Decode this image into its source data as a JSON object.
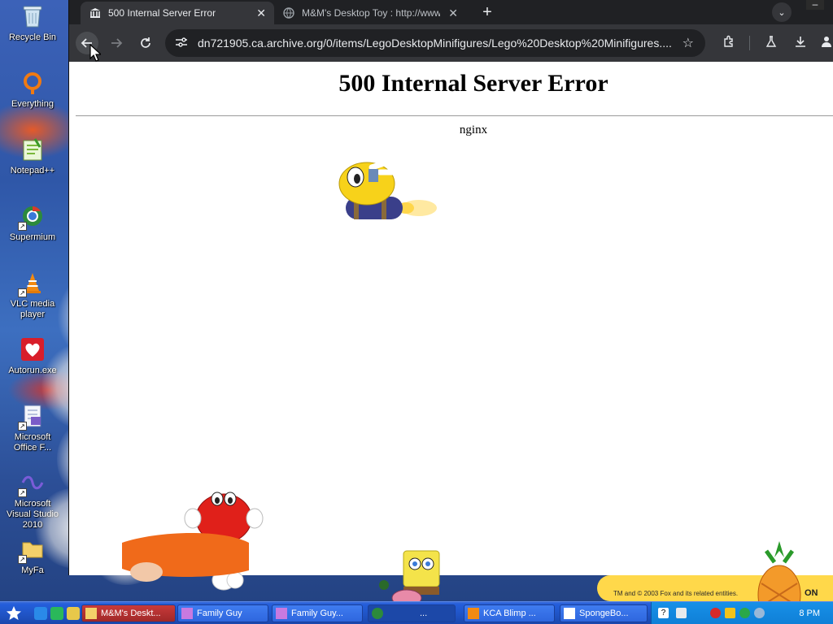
{
  "desktop": {
    "icons": [
      {
        "label": "Recycle Bin",
        "icon": "recycle-bin-icon"
      },
      {
        "label": "Everything",
        "icon": "everything-search-icon"
      },
      {
        "label": "Notepad++",
        "icon": "notepad-plus-plus-icon"
      },
      {
        "label": "Supermium",
        "icon": "supermium-browser-icon"
      },
      {
        "label": "VLC media player",
        "icon": "vlc-cone-icon"
      },
      {
        "label": "Autorun.exe",
        "icon": "autorun-heart-logo-icon"
      },
      {
        "label": "Microsoft Office F...",
        "icon": "office-document-icon"
      },
      {
        "label": "Microsoft Visual Studio 2010",
        "icon": "visual-studio-icon"
      },
      {
        "label": "MyFa",
        "icon": "folder-shortcut-icon"
      }
    ]
  },
  "browser": {
    "tabs": [
      {
        "title": "500 Internal Server Error",
        "favicon": "archive-building-icon",
        "active": true
      },
      {
        "title": "M&M's Desktop Toy : http://www.c",
        "favicon": "globe-icon",
        "active": false
      }
    ],
    "address": "dn721905.ca.archive.org/0/items/LegoDesktopMinifigures/Lego%20Desktop%20Minifigures....",
    "page": {
      "heading": "500 Internal Server Error",
      "server": "nginx"
    }
  },
  "banner": {
    "credit": "TM and © 2003 Fox and its related entities.",
    "on": "ON"
  },
  "taskbar": {
    "tasks": [
      {
        "label": "M&M's Deskt..."
      },
      {
        "label": "Family Guy"
      },
      {
        "label": "Family Guy..."
      },
      {
        "label": "..."
      },
      {
        "label": "KCA Blimp ..."
      },
      {
        "label": "SpongeBo..."
      }
    ],
    "clock": "8 PM"
  },
  "colors": {
    "chrome_dark": "#202124",
    "chrome_toolbar": "#35363a",
    "taskbar_blue": "#245edb",
    "tray_blue": "#0f7fd6"
  }
}
